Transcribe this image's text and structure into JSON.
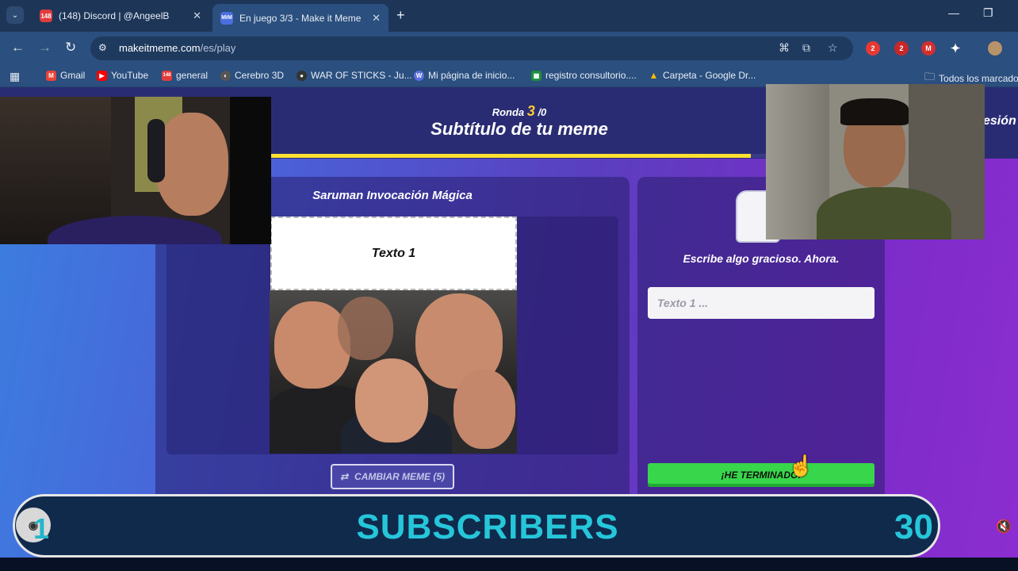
{
  "browser": {
    "tabs": [
      {
        "badge": "148",
        "title": "(148) Discord | @AngeelB",
        "close": "✕"
      },
      {
        "badge": "MiM",
        "title": "En juego 3/3 - Make it Meme",
        "close": "✕"
      }
    ],
    "new_tab": "+",
    "dropdown": "⌄",
    "url_host": "makeitmeme.com",
    "url_path": "/es/play",
    "bookmarks": [
      {
        "label": "Gmail",
        "icon": "M"
      },
      {
        "label": "YouTube",
        "icon": "▶"
      },
      {
        "label": "general",
        "icon": "148"
      },
      {
        "label": "Cerebro 3D",
        "icon": "◐"
      },
      {
        "label": "WAR OF STICKS - Ju...",
        "icon": "●"
      },
      {
        "label": "Mi página de inicio...",
        "icon": "W"
      },
      {
        "label": "registro consultorio....",
        "icon": "▦"
      },
      {
        "label": "Carpeta - Google Dr...",
        "icon": "▲"
      }
    ],
    "all_bookmarks": "Todos los marcado",
    "ext_badges": [
      "2",
      "2"
    ]
  },
  "game": {
    "round_prefix": "Ronda",
    "round_num": "3",
    "round_suffix": "/0",
    "subtitle": "Subtítulo de tu meme",
    "session_text": "esión",
    "progress": 0.97,
    "meme_title": "Saruman Invocación Mágica",
    "meme_text": "Texto 1",
    "swap_label": "CAMBIAR MEME (5)",
    "prompt": "Escribe algo gracioso. Ahora.",
    "input_placeholder": "Texto 1 ...",
    "done_label": "¡HE TERMINADO!"
  },
  "overlay": {
    "label": "SUBSCRIBERS",
    "count_right": "30",
    "count_left": "1"
  },
  "colors": {
    "accent_yellow": "#ffe033",
    "done_green": "#38d64a",
    "subscriber_cyan": "#26c6da"
  }
}
